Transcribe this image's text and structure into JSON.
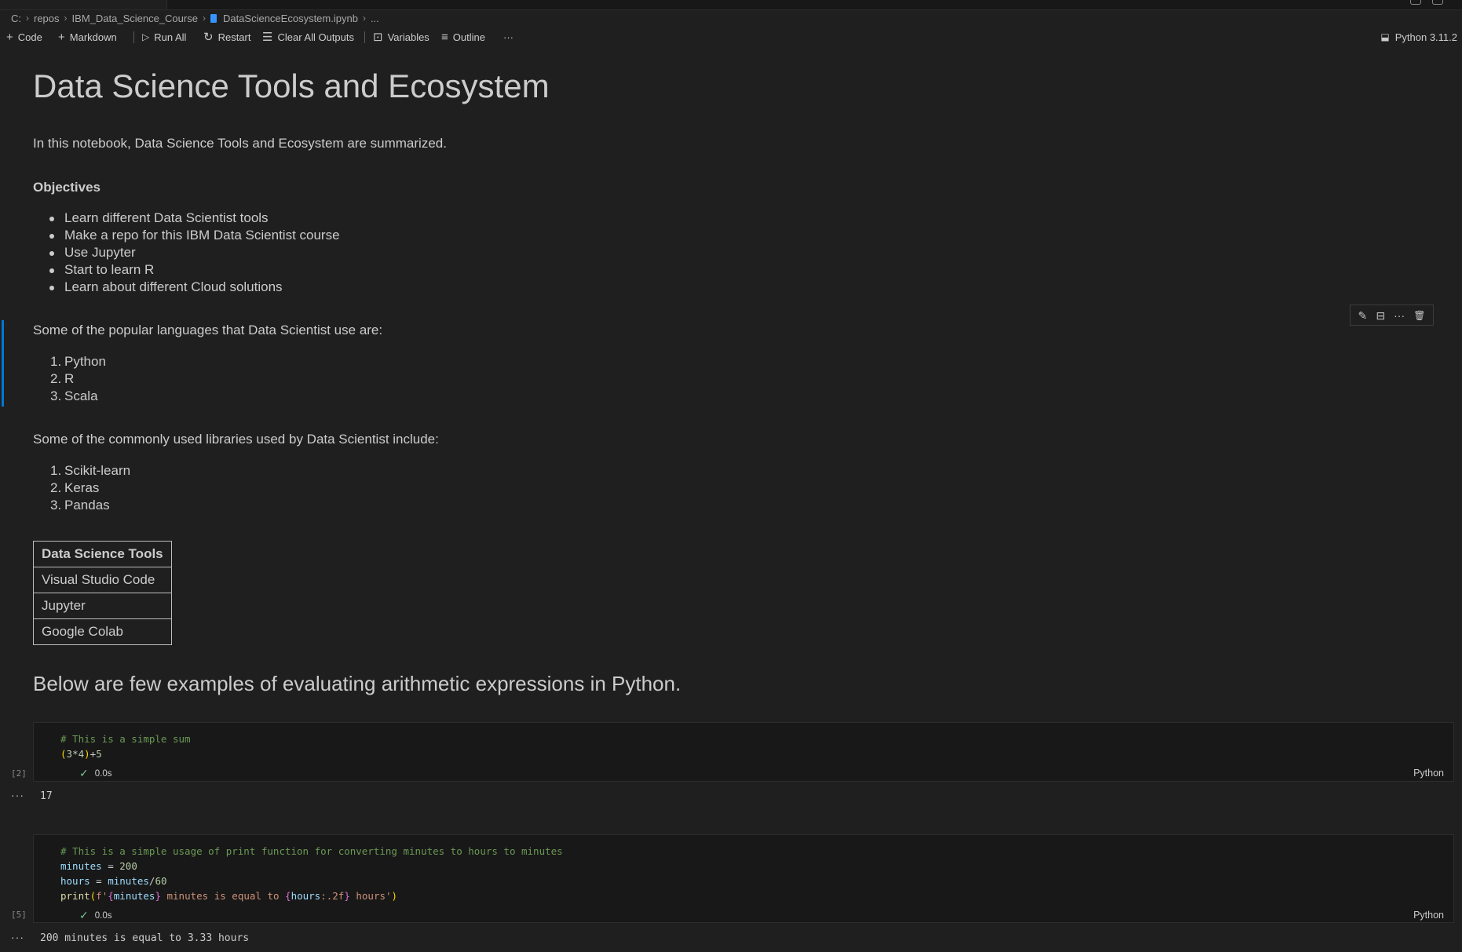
{
  "breadcrumb": {
    "items": [
      "C:",
      "repos",
      "IBM_Data_Science_Course",
      "DataScienceEcosystem.ipynb",
      "..."
    ]
  },
  "toolbar": {
    "code_label": "Code",
    "markdown_label": "Markdown",
    "run_all_label": "Run All",
    "restart_label": "Restart",
    "clear_outputs_label": "Clear All Outputs",
    "variables_label": "Variables",
    "outline_label": "Outline",
    "more_label": "···",
    "kernel_label": "Python 3.11.2"
  },
  "notebook": {
    "title": "Data Science Tools and Ecosystem",
    "intro": "In this notebook, Data Science Tools and Ecosystem are summarized.",
    "objectives_heading": "Objectives",
    "objectives": [
      "Learn different Data Scientist tools",
      "Make a repo for this IBM Data Scientist course",
      "Use Jupyter",
      "Start to learn R",
      "Learn about different Cloud solutions"
    ],
    "languages_intro": "Some of the popular languages that Data Scientist use are:",
    "languages": [
      {
        "num": "1.",
        "text": "Python"
      },
      {
        "num": "2.",
        "text": "R"
      },
      {
        "num": "3.",
        "text": "Scala"
      }
    ],
    "libraries_intro": "Some of the commonly used libraries used by Data Scientist include:",
    "libraries": [
      {
        "num": "1.",
        "text": "Scikit-learn"
      },
      {
        "num": "2.",
        "text": "Keras"
      },
      {
        "num": "3.",
        "text": "Pandas"
      }
    ],
    "tools_table": {
      "header": "Data Science Tools",
      "rows": [
        "Visual Studio Code",
        "Jupyter",
        "Google Colab"
      ]
    },
    "arith_heading": "Below are few examples of evaluating arithmetic expressions in Python."
  },
  "cells": [
    {
      "exec_count": "[2]",
      "status_time": "0.0s",
      "language": "Python",
      "code": {
        "comment": "# This is a simple sum",
        "expr_open": "(",
        "expr_a": "3",
        "expr_op": "*",
        "expr_b": "4",
        "expr_close": ")",
        "expr_plus": "+",
        "expr_c": "5"
      },
      "output_dots": "···",
      "output": "17"
    },
    {
      "exec_count": "[5]",
      "status_time": "0.0s",
      "language": "Python",
      "code": {
        "comment": "# This is a simple usage of print function for converting minutes to hours to minutes",
        "l2_var": "minutes",
        "l2_eq": " = ",
        "l2_num": "200",
        "l3_var": "hours",
        "l3_eq": " = ",
        "l3_var2": "minutes",
        "l3_div": "/",
        "l3_num": "60",
        "l4_fn": "print",
        "l4_p1": "(",
        "l4_f": "f'",
        "l4_b1": "{",
        "l4_v1": "minutes",
        "l4_b2": "}",
        "l4_s1": " minutes is equal to ",
        "l4_b3": "{",
        "l4_v2": "hours",
        "l4_fmt": ":.2f",
        "l4_b4": "}",
        "l4_s2": " hours'",
        "l4_p2": ")"
      },
      "output_dots": "···",
      "output": "200 minutes is equal to 3.33 hours"
    }
  ],
  "cell_toolbar": {
    "edit_icon": "✎",
    "split_icon": "⊟",
    "more_icon": "···",
    "delete_icon": "🗑"
  },
  "colors": {
    "background": "#1f1f1f",
    "accent": "#0078d4",
    "check": "#73c991",
    "comment": "#6a9955"
  }
}
